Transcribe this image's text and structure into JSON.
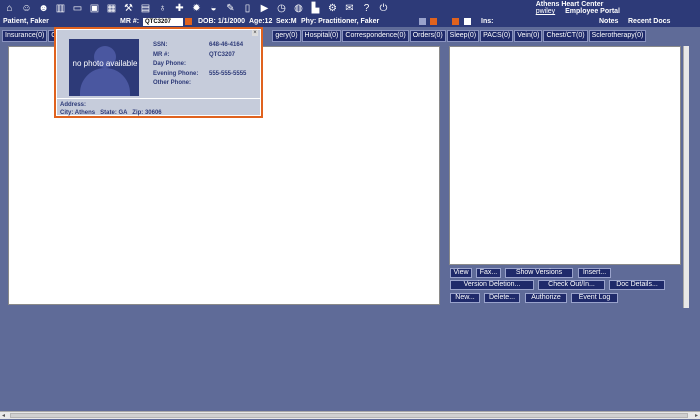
{
  "toolbar": {
    "icons": [
      "home-icon",
      "people-icon",
      "group-icon",
      "chart-icon",
      "monitor-icon",
      "id-card-icon",
      "calendar-icon",
      "hammer-icon",
      "notebook-icon",
      "stethoscope-icon",
      "hospital-icon",
      "burst-icon",
      "pill-icon",
      "pencil-icon",
      "document-icon",
      "video-icon",
      "clock-icon",
      "globe-icon",
      "building-icon",
      "gear-icon",
      "mail-icon",
      "help-icon",
      "power-icon"
    ],
    "brand_name": "Athens Heart Center",
    "user": "pwiley",
    "portal": "Employee Portal"
  },
  "patient_bar": {
    "name": "Patient, Faker",
    "mr_label": "MR #:",
    "mr_value": "QTC3207",
    "dob": "DOB: 1/1/2000",
    "age": "Age:12",
    "sex": "Sex:M",
    "phy": "Phy: Practitioner, Faker",
    "ins": "Ins:",
    "notes": "Notes",
    "recent_docs": "Recent Docs"
  },
  "tabs": [
    {
      "label": "Insurance(0)"
    },
    {
      "label": "C"
    },
    {
      "label": "gery(0)"
    },
    {
      "label": "Hospital(0)"
    },
    {
      "label": "Correspondence(0)"
    },
    {
      "label": "Orders(0)"
    },
    {
      "label": "Sleep(0)"
    },
    {
      "label": "PACS(0)"
    },
    {
      "label": "Vein(0)"
    },
    {
      "label": "Chest/CT(0)"
    },
    {
      "label": "Sclerotherapy(0)"
    }
  ],
  "buttons": {
    "view": "View",
    "fax": "Fax...",
    "show_versions": "Show Versions",
    "insert": "Insert...",
    "version_deletion": "Version Deletion...",
    "check_out_in": "Check Out/In...",
    "doc_details": "Doc Details...",
    "new": "New...",
    "delete": "Delete...",
    "authorize": "Authorize",
    "event_log": "Event Log"
  },
  "popup": {
    "photo_text": "no photo available",
    "ssn_label": "SSN:",
    "ssn_value": "648-46-4164",
    "mr_label": "MR #:",
    "mr_value": "QTC3207",
    "day_phone_label": "Day Phone:",
    "day_phone_value": "",
    "evening_phone_label": "Evening Phone:",
    "evening_phone_value": "555-555-5555",
    "other_phone_label": "Other Phone:",
    "other_phone_value": "",
    "address_label": "Address:",
    "city": "City:  Athens",
    "state": "State: GA",
    "zip": "Zip:  30606"
  },
  "colors": {
    "toolbar_bg": "#2d3a78",
    "workspace_bg": "#5f6b98",
    "popup_border": "#e0621e",
    "popup_bg": "#c6ccdb"
  }
}
